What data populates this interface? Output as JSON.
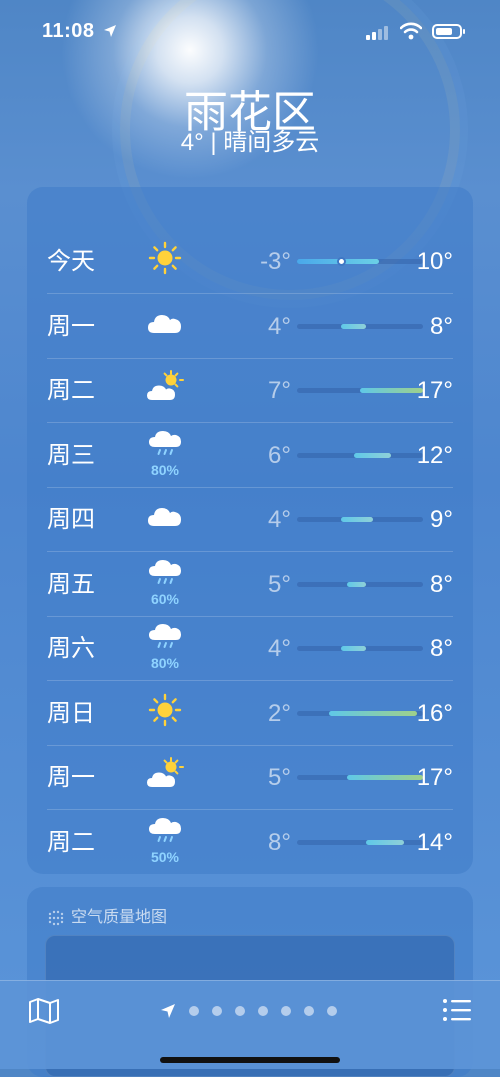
{
  "status_bar": {
    "time": "11:08"
  },
  "location": {
    "city": "雨花区",
    "summary": "4° | 晴间多云"
  },
  "forecast": [
    {
      "day": "今天",
      "icon": "sun-icon",
      "low": "-3°",
      "high": "10°",
      "low_val": -3,
      "high_val": 10,
      "current": 4
    },
    {
      "day": "周一",
      "icon": "cloud-icon",
      "low": "4°",
      "high": "8°",
      "low_val": 4,
      "high_val": 8
    },
    {
      "day": "周二",
      "icon": "partly-sunny-icon",
      "low": "7°",
      "high": "17°",
      "low_val": 7,
      "high_val": 17
    },
    {
      "day": "周三",
      "icon": "rain-cloud-icon",
      "precip": "80%",
      "low": "6°",
      "high": "12°",
      "low_val": 6,
      "high_val": 12
    },
    {
      "day": "周四",
      "icon": "cloud-icon",
      "low": "4°",
      "high": "9°",
      "low_val": 4,
      "high_val": 9
    },
    {
      "day": "周五",
      "icon": "rain-cloud-icon",
      "precip": "60%",
      "low": "5°",
      "high": "8°",
      "low_val": 5,
      "high_val": 8
    },
    {
      "day": "周六",
      "icon": "rain-cloud-icon",
      "precip": "80%",
      "low": "4°",
      "high": "8°",
      "low_val": 4,
      "high_val": 8
    },
    {
      "day": "周日",
      "icon": "sun-icon",
      "low": "2°",
      "high": "16°",
      "low_val": 2,
      "high_val": 16
    },
    {
      "day": "周一",
      "icon": "partly-sunny-icon",
      "low": "5°",
      "high": "17°",
      "low_val": 5,
      "high_val": 17
    },
    {
      "day": "周二",
      "icon": "rain-cloud-icon",
      "precip": "50%",
      "low": "8°",
      "high": "14°",
      "low_val": 8,
      "high_val": 14
    }
  ],
  "temp_range": [
    -3,
    17
  ],
  "air_quality": {
    "title": "空气质量地图"
  },
  "bottom_bar": {
    "page_dots": 7
  }
}
